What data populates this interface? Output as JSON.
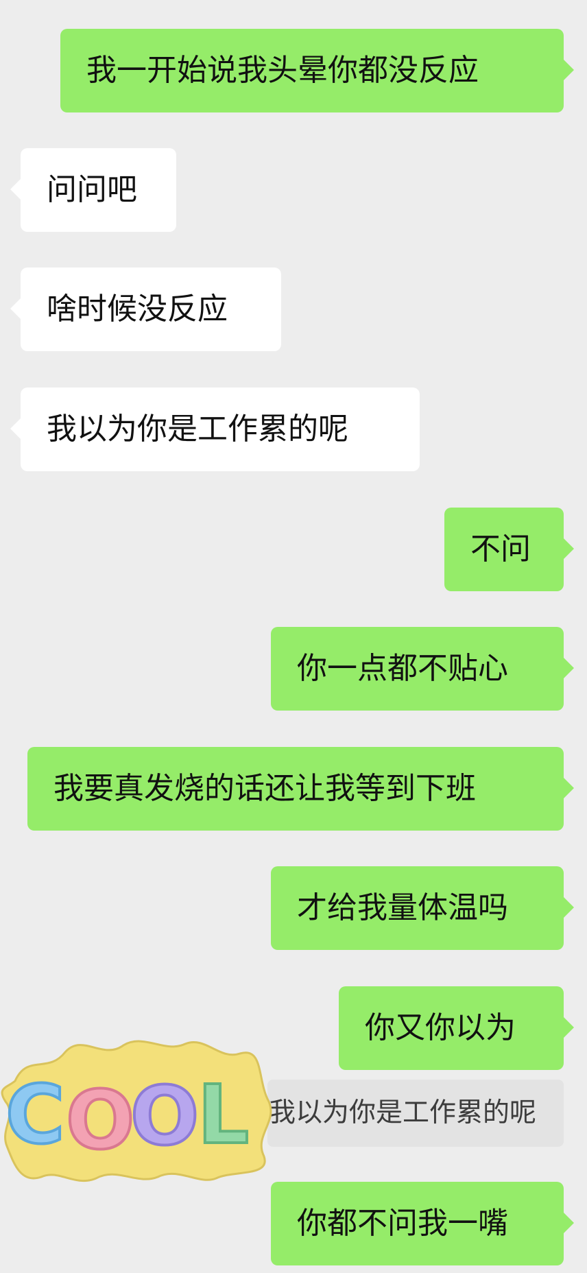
{
  "messages": [
    {
      "from": "me",
      "text": "我一开始说我头晕你都没反应"
    },
    {
      "from": "other",
      "text": "问问吧"
    },
    {
      "from": "other",
      "text": "啥时候没反应"
    },
    {
      "from": "other",
      "text": "我以为你是工作累的呢"
    },
    {
      "from": "me",
      "text": "不问"
    },
    {
      "from": "me",
      "text": "你一点都不贴心"
    },
    {
      "from": "me",
      "text": "我要真发烧的话还让我等到下班"
    },
    {
      "from": "me",
      "text": "才给我量体温吗"
    },
    {
      "from": "me",
      "text": "你又你以为"
    },
    {
      "from": "me",
      "text": "你都不问我一嘴"
    }
  ],
  "quote": {
    "text": "我以为你是工作累的呢"
  },
  "sticker": {
    "text": "COOL",
    "letter_colors": [
      "#8ec9f2",
      "#f3a2b3",
      "#b7a6ee",
      "#93d9a7"
    ],
    "blob_color": "#f3e07a"
  },
  "colors": {
    "background": "#ededed",
    "me_bubble": "#95ec69",
    "other_bubble": "#ffffff",
    "quote_bg": "#e3e3e3"
  }
}
